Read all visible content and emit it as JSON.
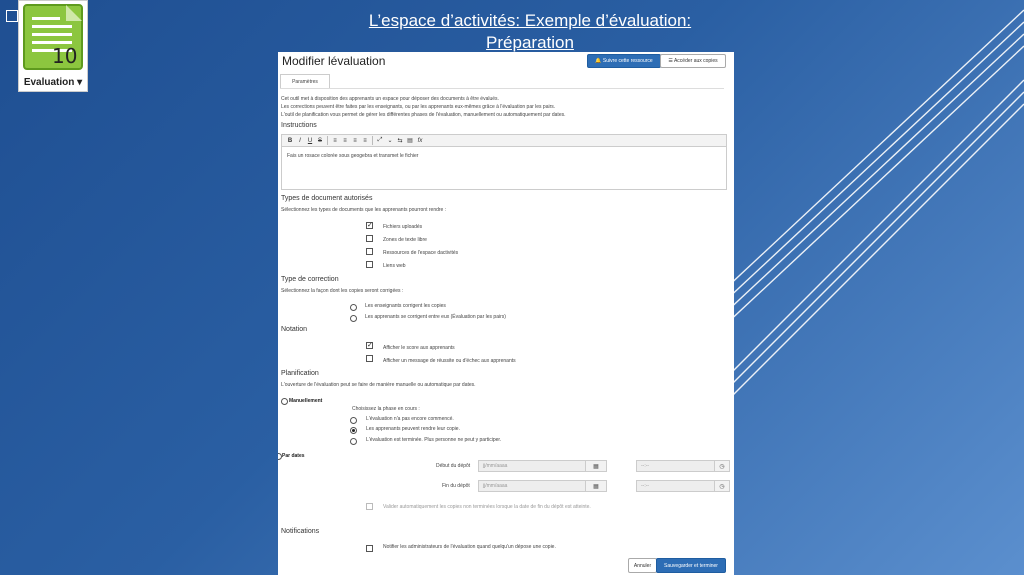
{
  "slide": {
    "title_line1": "L’espace d’activités: Exemple d’évaluation:",
    "title_line2": "Préparation"
  },
  "logo": {
    "label": "Evaluation ▾",
    "icon_text": "10"
  },
  "header": {
    "title": "Modifier lévaluation",
    "follow_button": "🔔 Suivre cette ressource",
    "access_button": "☰ Accéder aux copies"
  },
  "tabs": [
    "Paramètres"
  ],
  "intro": {
    "line1": "Cet outil met à disposition des apprenants un espace pour déposer des documents à être évalués.",
    "line2": "Les corrections peuvent être faites par les enseignants, ou par les apprenants eux-mêmes grâce à l'évaluation par les pairs.",
    "line3": "L'outil de planification vous permet de gérer les différentes phases de l'évaluation, manuellement ou automatiquement par dates."
  },
  "instructions": {
    "title": "Instructions",
    "toolbar": [
      "B",
      "I",
      "U",
      "S",
      "≡",
      "≡",
      "≡",
      "≡",
      "⤢",
      "⌄",
      "⇆",
      "▤",
      "fx"
    ],
    "content": "Fais un rosace colorée sous geogebra et transmet le fichier"
  },
  "doc_types": {
    "title": "Types de document autorisés",
    "subtitle": "Sélectionnez les types de documents que les apprenants pourront rendre :",
    "options": [
      {
        "label": "Fichiers uploadés",
        "checked": true
      },
      {
        "label": "Zones de texte libre",
        "checked": false
      },
      {
        "label": "Ressources de l'espace dactivités",
        "checked": false
      },
      {
        "label": "Liens web",
        "checked": false
      }
    ]
  },
  "correction": {
    "title": "Type de correction",
    "subtitle": "Sélectionnez la façon dont les copies seront corrigées :",
    "options": [
      {
        "label": "Les enseignants corrigent les copies",
        "selected": false
      },
      {
        "label": "Les apprenants se corrigent entre eux (Évaluation par les pairs)",
        "selected": false
      }
    ]
  },
  "notation": {
    "title": "Notation",
    "options": [
      {
        "label": "Afficher le score aux apprenants",
        "checked": true
      },
      {
        "label": "Afficher un message de réussite ou d'échec aux apprenants",
        "checked": false
      }
    ]
  },
  "planning": {
    "title": "Planification",
    "subtitle": "L'ouverture de l'évaluation peut se faire de manière manuelle ou automatique par dates.",
    "manual_label": "Manuellement",
    "phase_prompt": "Choisissez la phase en cours :",
    "phases": [
      {
        "label": "L'évaluation n'a pas encore commencé.",
        "selected": false
      },
      {
        "label": "Les apprenants peuvent rendre leur copie.",
        "selected": true
      },
      {
        "label": "L'évaluation est terminée. Plus personne ne peut y participer.",
        "selected": false
      }
    ],
    "dates_label": "Par dates",
    "start_label": "Début du dépôt",
    "end_label": "Fin du dépôt",
    "date_placeholder": "jj/mm/aaaa",
    "time_placeholder": "--:--",
    "calendar_icon": "▦",
    "clock_icon": "◷",
    "auto_validate": "Valider automatiquement les copies non terminées lorsque la date de fin du dépôt est atteinte."
  },
  "notifications": {
    "title": "Notifications",
    "option": "Notifier les administrateurs de l'évaluation quand quelqu'un dépose une copie."
  },
  "footer": {
    "cancel": "Annuler",
    "save": "Sauvegarder et terminer"
  }
}
